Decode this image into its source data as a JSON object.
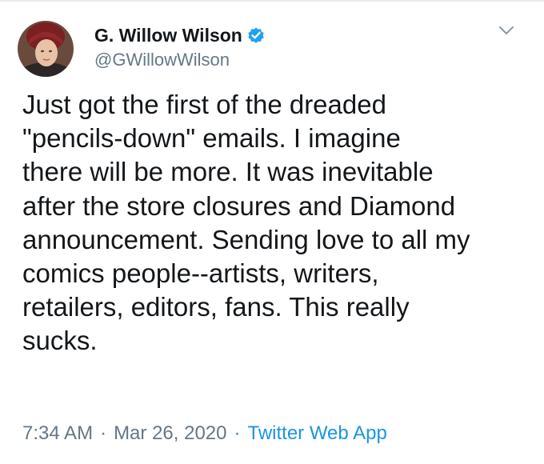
{
  "author": {
    "display_name": "G. Willow Wilson",
    "handle": "@GWillowWilson",
    "verified": true
  },
  "tweet": {
    "text_lines": [
      "Just got the first of the dreaded",
      "\"pencils-down\" emails. I imagine",
      "there will be more. It was inevitable",
      "after the store closures and Diamond",
      "announcement. Sending love to all my",
      "comics people--artists, writers,",
      "retailers, editors, fans. This really",
      "sucks."
    ],
    "time": "7:34 AM",
    "separator": "·",
    "date": "Mar 26, 2020",
    "source": "Twitter Web App"
  },
  "icons": {
    "verified": "verified-badge-icon",
    "menu": "chevron-down-icon"
  },
  "colors": {
    "text": "#14171a",
    "secondary": "#657786",
    "accent": "#1b95e0",
    "verified": "#1da1f2"
  }
}
